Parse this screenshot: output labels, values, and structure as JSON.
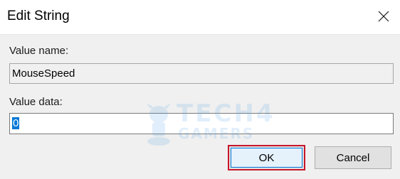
{
  "window": {
    "title": "Edit String",
    "close_icon": "close-icon"
  },
  "form": {
    "value_name_label": "Value name:",
    "value_name": "MouseSpeed",
    "value_data_label": "Value data:",
    "value_data": "0"
  },
  "buttons": {
    "ok_label": "OK",
    "cancel_label": "Cancel"
  },
  "watermark": {
    "line1": "TECH4",
    "line2": "GAMERS"
  },
  "colors": {
    "accent": "#0078d7",
    "highlight_border": "#c7162b",
    "dialog_background": "#f0f0f0"
  }
}
